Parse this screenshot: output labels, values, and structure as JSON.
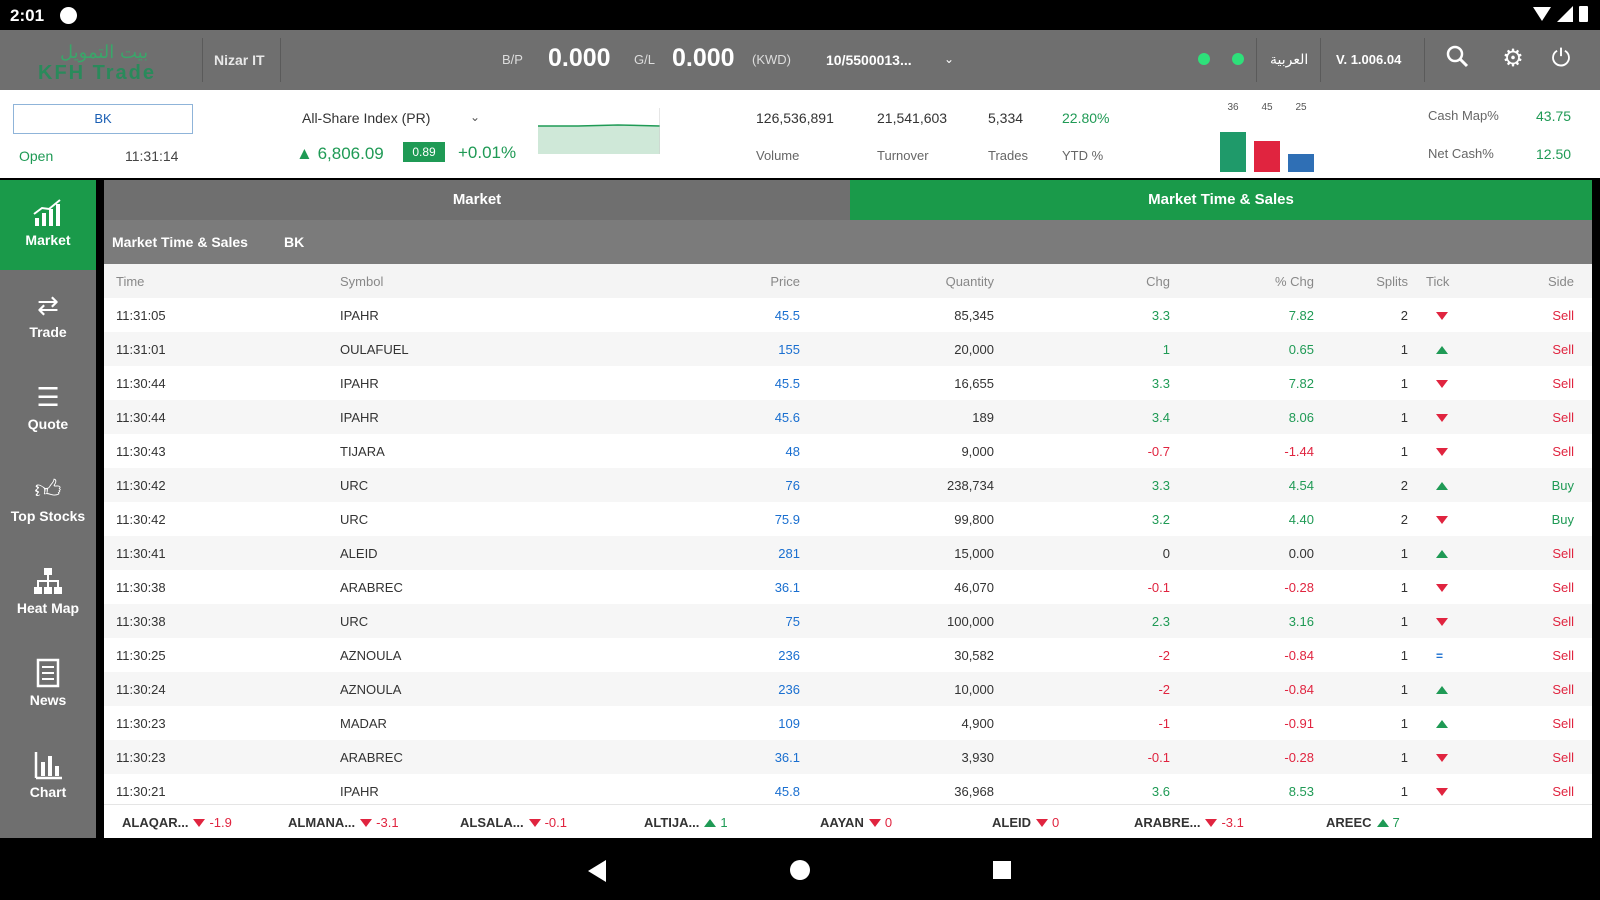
{
  "status_bar": {
    "time": "2:01"
  },
  "topbar": {
    "logo_text": "KFH Trade",
    "logo_ar": "بيت التمويل",
    "user": "Nizar IT",
    "bp_label": "B/P",
    "bp_value": "0.000",
    "gl_label": "G/L",
    "gl_value": "0.000",
    "currency": "(KWD)",
    "account": "10/5500013...",
    "language": "العربية",
    "version": "V. 1.006.04"
  },
  "infobar": {
    "symbol": "BK",
    "open_label": "Open",
    "open_time": "11:31:14",
    "index_name": "All-Share Index (PR)",
    "index_value": "6,806.09",
    "index_change": "0.89",
    "index_pct": "+0.01%",
    "volume": "126,536,891",
    "volume_label": "Volume",
    "turnover": "21,541,603",
    "turnover_label": "Turnover",
    "trades": "5,334",
    "trades_label": "Trades",
    "ytd": "22.80%",
    "ytd_label": "YTD %",
    "bars": [
      {
        "label": "36",
        "value": 36,
        "color": "#1f9a6a"
      },
      {
        "label": "45",
        "value": 28,
        "color": "#e0243f"
      },
      {
        "label": "25",
        "value": 16,
        "color": "#2f6fb5"
      }
    ],
    "cash_map_label": "Cash Map%",
    "cash_map_value": "43.75",
    "net_cash_label": "Net Cash%",
    "net_cash_value": "12.50"
  },
  "sidebar": {
    "items": [
      {
        "label": "Market",
        "icon": "chart-trend-icon"
      },
      {
        "label": "Trade",
        "icon": "arrows-icon"
      },
      {
        "label": "Quote",
        "icon": "list-icon"
      },
      {
        "label": "Top Stocks",
        "icon": "thumb-up-icon"
      },
      {
        "label": "Heat Map",
        "icon": "hierarchy-icon"
      },
      {
        "label": "News",
        "icon": "newspaper-icon"
      },
      {
        "label": "Chart",
        "icon": "bar-chart-icon"
      }
    ]
  },
  "tabs": {
    "market": "Market",
    "mts": "Market Time & Sales"
  },
  "subheader": {
    "title": "Market Time & Sales",
    "symbol": "BK"
  },
  "columns": {
    "time": "Time",
    "symbol": "Symbol",
    "price": "Price",
    "quantity": "Quantity",
    "chg": "Chg",
    "pct_chg": "% Chg",
    "splits": "Splits",
    "tick": "Tick",
    "side": "Side"
  },
  "rows": [
    {
      "time": "11:31:05",
      "symbol": "IPAHR",
      "price": "45.5",
      "qty": "85,345",
      "chg": "3.3",
      "pct": "7.82",
      "splits": "2",
      "tick": "down",
      "side": "Sell"
    },
    {
      "time": "11:31:01",
      "symbol": "OULAFUEL",
      "price": "155",
      "qty": "20,000",
      "chg": "1",
      "pct": "0.65",
      "splits": "1",
      "tick": "up",
      "side": "Sell"
    },
    {
      "time": "11:30:44",
      "symbol": "IPAHR",
      "price": "45.5",
      "qty": "16,655",
      "chg": "3.3",
      "pct": "7.82",
      "splits": "1",
      "tick": "down",
      "side": "Sell"
    },
    {
      "time": "11:30:44",
      "symbol": "IPAHR",
      "price": "45.6",
      "qty": "189",
      "chg": "3.4",
      "pct": "8.06",
      "splits": "1",
      "tick": "down",
      "side": "Sell"
    },
    {
      "time": "11:30:43",
      "symbol": "TIJARA",
      "price": "48",
      "qty": "9,000",
      "chg": "-0.7",
      "pct": "-1.44",
      "splits": "1",
      "tick": "down",
      "side": "Sell"
    },
    {
      "time": "11:30:42",
      "symbol": "URC",
      "price": "76",
      "qty": "238,734",
      "chg": "3.3",
      "pct": "4.54",
      "splits": "2",
      "tick": "up",
      "side": "Buy"
    },
    {
      "time": "11:30:42",
      "symbol": "URC",
      "price": "75.9",
      "qty": "99,800",
      "chg": "3.2",
      "pct": "4.40",
      "splits": "2",
      "tick": "down",
      "side": "Buy"
    },
    {
      "time": "11:30:41",
      "symbol": "ALEID",
      "price": "281",
      "qty": "15,000",
      "chg": "0",
      "pct": "0.00",
      "splits": "1",
      "tick": "up",
      "side": "Sell"
    },
    {
      "time": "11:30:38",
      "symbol": "ARABREC",
      "price": "36.1",
      "qty": "46,070",
      "chg": "-0.1",
      "pct": "-0.28",
      "splits": "1",
      "tick": "down",
      "side": "Sell"
    },
    {
      "time": "11:30:38",
      "symbol": "URC",
      "price": "75",
      "qty": "100,000",
      "chg": "2.3",
      "pct": "3.16",
      "splits": "1",
      "tick": "down",
      "side": "Sell"
    },
    {
      "time": "11:30:25",
      "symbol": "AZNOULA",
      "price": "236",
      "qty": "30,582",
      "chg": "-2",
      "pct": "-0.84",
      "splits": "1",
      "tick": "eq",
      "side": "Sell"
    },
    {
      "time": "11:30:24",
      "symbol": "AZNOULA",
      "price": "236",
      "qty": "10,000",
      "chg": "-2",
      "pct": "-0.84",
      "splits": "1",
      "tick": "up",
      "side": "Sell"
    },
    {
      "time": "11:30:23",
      "symbol": "MADAR",
      "price": "109",
      "qty": "4,900",
      "chg": "-1",
      "pct": "-0.91",
      "splits": "1",
      "tick": "up",
      "side": "Sell"
    },
    {
      "time": "11:30:23",
      "symbol": "ARABREC",
      "price": "36.1",
      "qty": "3,930",
      "chg": "-0.1",
      "pct": "-0.28",
      "splits": "1",
      "tick": "down",
      "side": "Sell"
    },
    {
      "time": "11:30:21",
      "symbol": "IPAHR",
      "price": "45.8",
      "qty": "36,968",
      "chg": "3.6",
      "pct": "8.53",
      "splits": "1",
      "tick": "down",
      "side": "Sell"
    }
  ],
  "ticker": [
    {
      "name": "ALAQAR...",
      "dir": "down",
      "value": "-1.9"
    },
    {
      "name": "ALMANA...",
      "dir": "down",
      "value": "-3.1"
    },
    {
      "name": "ALSALA...",
      "dir": "down",
      "value": "-0.1"
    },
    {
      "name": "ALTIJA...",
      "dir": "up",
      "value": "1"
    },
    {
      "name": "AAYAN",
      "dir": "down",
      "value": "0"
    },
    {
      "name": "ALEID",
      "dir": "down",
      "value": "0"
    },
    {
      "name": "ARABRE...",
      "dir": "down",
      "value": "-3.1"
    },
    {
      "name": "AREEC",
      "dir": "up",
      "value": "7"
    }
  ]
}
